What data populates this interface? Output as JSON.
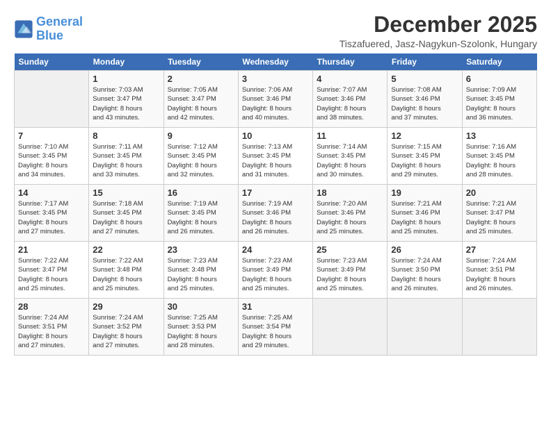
{
  "logo": {
    "line1": "General",
    "line2": "Blue"
  },
  "title": "December 2025",
  "location": "Tiszafuered, Jasz-Nagykun-Szolonk, Hungary",
  "days_of_week": [
    "Sunday",
    "Monday",
    "Tuesday",
    "Wednesday",
    "Thursday",
    "Friday",
    "Saturday"
  ],
  "weeks": [
    [
      {
        "day": "",
        "sunrise": "",
        "sunset": "",
        "daylight": ""
      },
      {
        "day": "1",
        "sunrise": "Sunrise: 7:03 AM",
        "sunset": "Sunset: 3:47 PM",
        "daylight": "Daylight: 8 hours and 43 minutes."
      },
      {
        "day": "2",
        "sunrise": "Sunrise: 7:05 AM",
        "sunset": "Sunset: 3:47 PM",
        "daylight": "Daylight: 8 hours and 42 minutes."
      },
      {
        "day": "3",
        "sunrise": "Sunrise: 7:06 AM",
        "sunset": "Sunset: 3:46 PM",
        "daylight": "Daylight: 8 hours and 40 minutes."
      },
      {
        "day": "4",
        "sunrise": "Sunrise: 7:07 AM",
        "sunset": "Sunset: 3:46 PM",
        "daylight": "Daylight: 8 hours and 38 minutes."
      },
      {
        "day": "5",
        "sunrise": "Sunrise: 7:08 AM",
        "sunset": "Sunset: 3:46 PM",
        "daylight": "Daylight: 8 hours and 37 minutes."
      },
      {
        "day": "6",
        "sunrise": "Sunrise: 7:09 AM",
        "sunset": "Sunset: 3:45 PM",
        "daylight": "Daylight: 8 hours and 36 minutes."
      }
    ],
    [
      {
        "day": "7",
        "sunrise": "Sunrise: 7:10 AM",
        "sunset": "Sunset: 3:45 PM",
        "daylight": "Daylight: 8 hours and 34 minutes."
      },
      {
        "day": "8",
        "sunrise": "Sunrise: 7:11 AM",
        "sunset": "Sunset: 3:45 PM",
        "daylight": "Daylight: 8 hours and 33 minutes."
      },
      {
        "day": "9",
        "sunrise": "Sunrise: 7:12 AM",
        "sunset": "Sunset: 3:45 PM",
        "daylight": "Daylight: 8 hours and 32 minutes."
      },
      {
        "day": "10",
        "sunrise": "Sunrise: 7:13 AM",
        "sunset": "Sunset: 3:45 PM",
        "daylight": "Daylight: 8 hours and 31 minutes."
      },
      {
        "day": "11",
        "sunrise": "Sunrise: 7:14 AM",
        "sunset": "Sunset: 3:45 PM",
        "daylight": "Daylight: 8 hours and 30 minutes."
      },
      {
        "day": "12",
        "sunrise": "Sunrise: 7:15 AM",
        "sunset": "Sunset: 3:45 PM",
        "daylight": "Daylight: 8 hours and 29 minutes."
      },
      {
        "day": "13",
        "sunrise": "Sunrise: 7:16 AM",
        "sunset": "Sunset: 3:45 PM",
        "daylight": "Daylight: 8 hours and 28 minutes."
      }
    ],
    [
      {
        "day": "14",
        "sunrise": "Sunrise: 7:17 AM",
        "sunset": "Sunset: 3:45 PM",
        "daylight": "Daylight: 8 hours and 27 minutes."
      },
      {
        "day": "15",
        "sunrise": "Sunrise: 7:18 AM",
        "sunset": "Sunset: 3:45 PM",
        "daylight": "Daylight: 8 hours and 27 minutes."
      },
      {
        "day": "16",
        "sunrise": "Sunrise: 7:19 AM",
        "sunset": "Sunset: 3:45 PM",
        "daylight": "Daylight: 8 hours and 26 minutes."
      },
      {
        "day": "17",
        "sunrise": "Sunrise: 7:19 AM",
        "sunset": "Sunset: 3:46 PM",
        "daylight": "Daylight: 8 hours and 26 minutes."
      },
      {
        "day": "18",
        "sunrise": "Sunrise: 7:20 AM",
        "sunset": "Sunset: 3:46 PM",
        "daylight": "Daylight: 8 hours and 25 minutes."
      },
      {
        "day": "19",
        "sunrise": "Sunrise: 7:21 AM",
        "sunset": "Sunset: 3:46 PM",
        "daylight": "Daylight: 8 hours and 25 minutes."
      },
      {
        "day": "20",
        "sunrise": "Sunrise: 7:21 AM",
        "sunset": "Sunset: 3:47 PM",
        "daylight": "Daylight: 8 hours and 25 minutes."
      }
    ],
    [
      {
        "day": "21",
        "sunrise": "Sunrise: 7:22 AM",
        "sunset": "Sunset: 3:47 PM",
        "daylight": "Daylight: 8 hours and 25 minutes."
      },
      {
        "day": "22",
        "sunrise": "Sunrise: 7:22 AM",
        "sunset": "Sunset: 3:48 PM",
        "daylight": "Daylight: 8 hours and 25 minutes."
      },
      {
        "day": "23",
        "sunrise": "Sunrise: 7:23 AM",
        "sunset": "Sunset: 3:48 PM",
        "daylight": "Daylight: 8 hours and 25 minutes."
      },
      {
        "day": "24",
        "sunrise": "Sunrise: 7:23 AM",
        "sunset": "Sunset: 3:49 PM",
        "daylight": "Daylight: 8 hours and 25 minutes."
      },
      {
        "day": "25",
        "sunrise": "Sunrise: 7:23 AM",
        "sunset": "Sunset: 3:49 PM",
        "daylight": "Daylight: 8 hours and 25 minutes."
      },
      {
        "day": "26",
        "sunrise": "Sunrise: 7:24 AM",
        "sunset": "Sunset: 3:50 PM",
        "daylight": "Daylight: 8 hours and 26 minutes."
      },
      {
        "day": "27",
        "sunrise": "Sunrise: 7:24 AM",
        "sunset": "Sunset: 3:51 PM",
        "daylight": "Daylight: 8 hours and 26 minutes."
      }
    ],
    [
      {
        "day": "28",
        "sunrise": "Sunrise: 7:24 AM",
        "sunset": "Sunset: 3:51 PM",
        "daylight": "Daylight: 8 hours and 27 minutes."
      },
      {
        "day": "29",
        "sunrise": "Sunrise: 7:24 AM",
        "sunset": "Sunset: 3:52 PM",
        "daylight": "Daylight: 8 hours and 27 minutes."
      },
      {
        "day": "30",
        "sunrise": "Sunrise: 7:25 AM",
        "sunset": "Sunset: 3:53 PM",
        "daylight": "Daylight: 8 hours and 28 minutes."
      },
      {
        "day": "31",
        "sunrise": "Sunrise: 7:25 AM",
        "sunset": "Sunset: 3:54 PM",
        "daylight": "Daylight: 8 hours and 29 minutes."
      },
      {
        "day": "",
        "sunrise": "",
        "sunset": "",
        "daylight": ""
      },
      {
        "day": "",
        "sunrise": "",
        "sunset": "",
        "daylight": ""
      },
      {
        "day": "",
        "sunrise": "",
        "sunset": "",
        "daylight": ""
      }
    ]
  ]
}
